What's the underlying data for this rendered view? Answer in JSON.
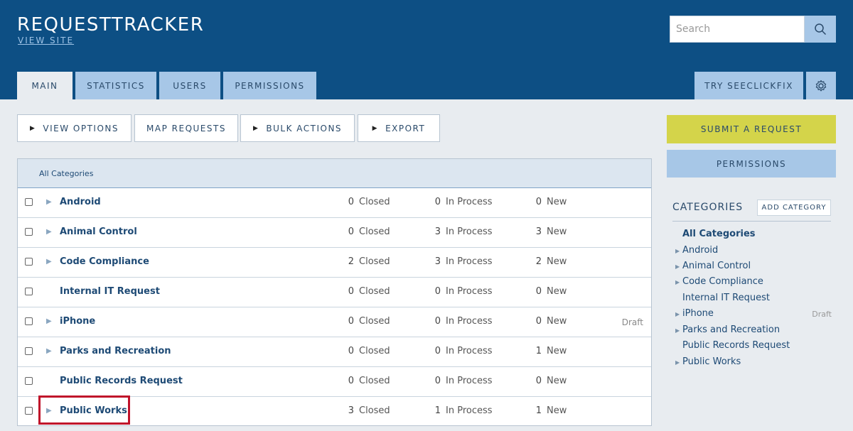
{
  "header": {
    "brand": "REQUESTTRACKER",
    "view_site": "VIEW SITE",
    "search_placeholder": "Search",
    "tabs": [
      "MAIN",
      "STATISTICS",
      "USERS",
      "PERMISSIONS"
    ],
    "try_label": "TRY SEECLICKFIX"
  },
  "toolbar": {
    "view_options": "VIEW OPTIONS",
    "map_requests": "MAP REQUESTS",
    "bulk_actions": "BULK ACTIONS",
    "export": "EXPORT"
  },
  "table": {
    "header": "All Categories",
    "closed_label": "Closed",
    "in_process_label": "In Process",
    "new_label": "New",
    "rows": [
      {
        "name": "Android",
        "expandable": true,
        "closed": "0",
        "in_process": "0",
        "new": "0",
        "draft": ""
      },
      {
        "name": "Animal Control",
        "expandable": true,
        "closed": "0",
        "in_process": "3",
        "new": "3",
        "draft": ""
      },
      {
        "name": "Code Compliance",
        "expandable": true,
        "closed": "2",
        "in_process": "3",
        "new": "2",
        "draft": ""
      },
      {
        "name": "Internal IT Request",
        "expandable": false,
        "closed": "0",
        "in_process": "0",
        "new": "0",
        "draft": ""
      },
      {
        "name": "iPhone",
        "expandable": true,
        "closed": "0",
        "in_process": "0",
        "new": "0",
        "draft": "Draft"
      },
      {
        "name": "Parks and Recreation",
        "expandable": true,
        "closed": "0",
        "in_process": "0",
        "new": "1",
        "draft": ""
      },
      {
        "name": "Public Records Request",
        "expandable": false,
        "closed": "0",
        "in_process": "0",
        "new": "0",
        "draft": ""
      },
      {
        "name": "Public Works",
        "expandable": true,
        "closed": "3",
        "in_process": "1",
        "new": "1",
        "draft": ""
      }
    ]
  },
  "sidebar": {
    "submit": "SUBMIT A REQUEST",
    "permissions": "PERMISSIONS",
    "categories_title": "CATEGORIES",
    "add_category": "ADD CATEGORY",
    "items": [
      {
        "label": "All Categories",
        "expandable": false,
        "draft": ""
      },
      {
        "label": "Android",
        "expandable": true,
        "draft": ""
      },
      {
        "label": "Animal Control",
        "expandable": true,
        "draft": ""
      },
      {
        "label": "Code Compliance",
        "expandable": true,
        "draft": ""
      },
      {
        "label": "Internal IT Request",
        "expandable": false,
        "draft": ""
      },
      {
        "label": "iPhone",
        "expandable": true,
        "draft": "Draft"
      },
      {
        "label": "Parks and Recreation",
        "expandable": true,
        "draft": ""
      },
      {
        "label": "Public Records Request",
        "expandable": false,
        "draft": ""
      },
      {
        "label": "Public Works",
        "expandable": true,
        "draft": ""
      }
    ]
  },
  "colors": {
    "header_bg": "#0d4f84",
    "tab_bg": "#a7c7e7",
    "submit_bg": "#d4d44a",
    "highlight": "#c0122a"
  }
}
